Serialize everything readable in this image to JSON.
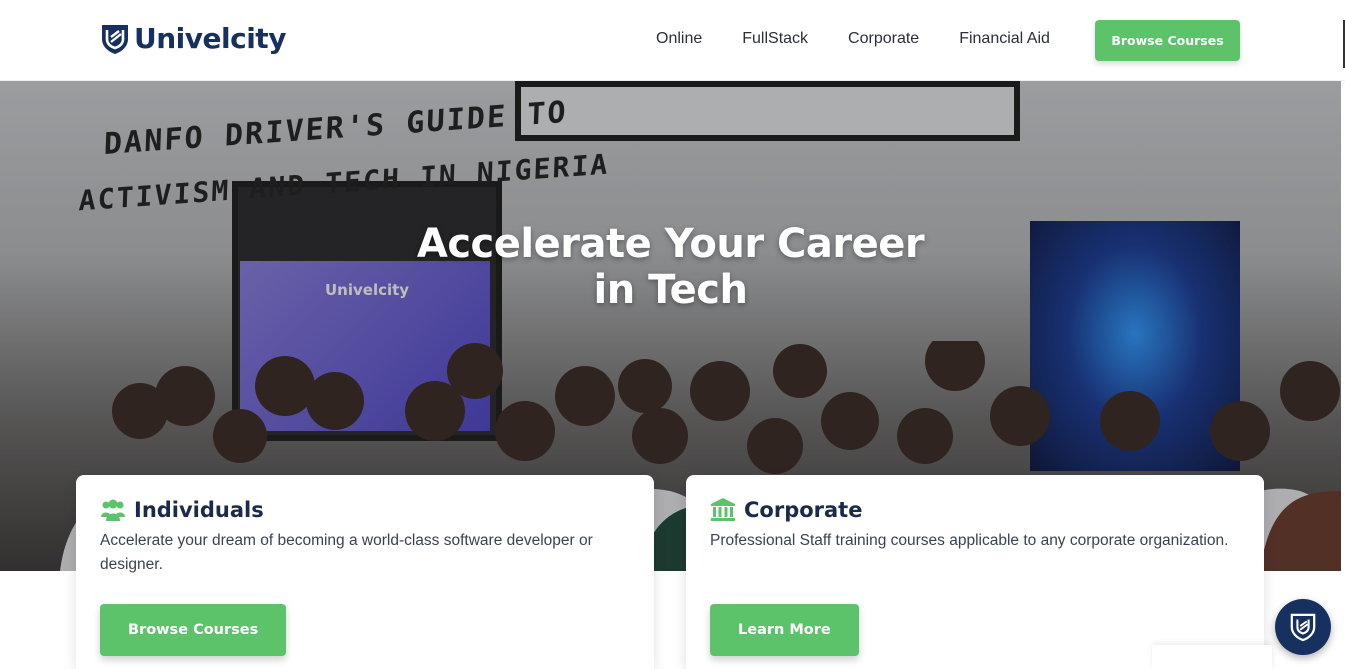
{
  "brand": {
    "name": "Univelcity",
    "icon": "shield-u-logo-icon"
  },
  "nav": {
    "links": [
      "Online",
      "FullStack",
      "Corporate",
      "Financial Aid"
    ],
    "cta_label": "Browse Courses"
  },
  "hero": {
    "title_line1": "Accelerate Your Career",
    "title_line2": "in Tech",
    "wall_text_line1": "DANFO DRIVER'S GUIDE TO",
    "wall_text_line2": "ACTIVISM AND TECH IN NIGERIA",
    "screen_logo_text": "Univelcity"
  },
  "cards": [
    {
      "icon": "users-group-icon",
      "title": "Individuals",
      "description": "Accelerate your dream of becoming a world-class software developer or designer.",
      "button_label": "Browse Courses"
    },
    {
      "icon": "bank-building-icon",
      "title": "Corporate",
      "description": "Professional Staff training courses applicable to any corporate organization.",
      "button_label": "Learn More"
    }
  ],
  "colors": {
    "accent_green": "#5cc36a",
    "brand_navy": "#16305f",
    "text_dark": "#1b2a4a"
  },
  "widget": {
    "icon": "shield-u-chat-icon"
  }
}
